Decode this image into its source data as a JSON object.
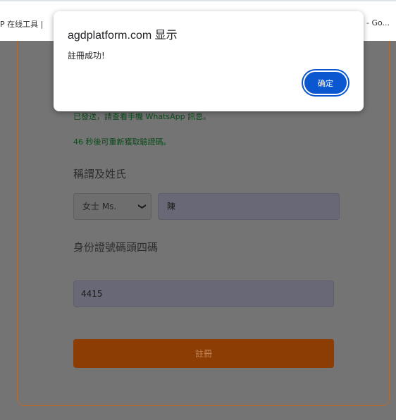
{
  "bookmarks": {
    "left_text": "P 在线工具 | ",
    "right_text": "- Go..."
  },
  "form": {
    "sent_message": "已發送，請查看手機 WhatsApp 訊息。",
    "resend_message": "46 秒後可重新獲取驗證碼。",
    "name_label": "稱謂及姓氏",
    "title_select_value": "女士 Ms.",
    "surname_value": "陳",
    "id_label": "身份證號碼頭四碼",
    "id_value": "4415",
    "register_button": "註冊"
  },
  "dialog": {
    "title": "agdplatform.com 显示",
    "message": "註冊成功!",
    "ok_button": "确定"
  },
  "colors": {
    "overlay_page": "#747474",
    "register_button": "#8c3d04",
    "dialog_ok_button": "#0b57d0"
  }
}
